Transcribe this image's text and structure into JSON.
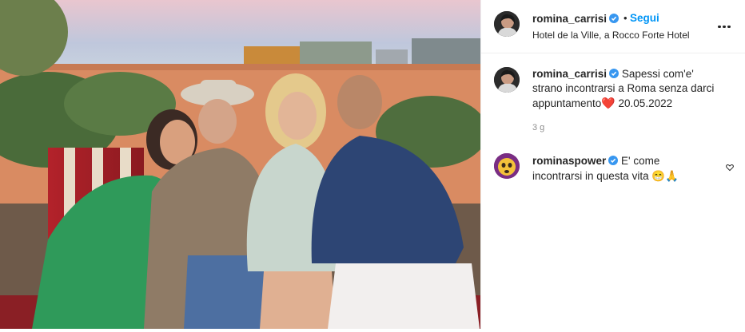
{
  "post": {
    "author": {
      "username": "romina_carrisi",
      "verified": true,
      "follow_label": "Segui",
      "separator": "•",
      "location": "Hotel de la Ville, a Rocco Forte Hotel"
    },
    "caption": {
      "username": "romina_carrisi",
      "text": "Sapessi com'e' strano incontrarsi a Roma senza darci appuntamento",
      "emoji": "❤️",
      "date": "20.05.2022",
      "age": "3 g"
    },
    "comments": [
      {
        "username": "rominaspower",
        "verified": true,
        "text": "E' come incontrarsi in questa vita",
        "emoji": "😁🙏"
      }
    ]
  },
  "icons": {
    "verified": "verified-badge-icon",
    "more": "more-options-icon",
    "like": "heart-outline-icon"
  },
  "colors": {
    "follow": "#0095f6",
    "verified": "#3897f0",
    "divider": "#efefef",
    "muted": "#8e8e8e"
  }
}
